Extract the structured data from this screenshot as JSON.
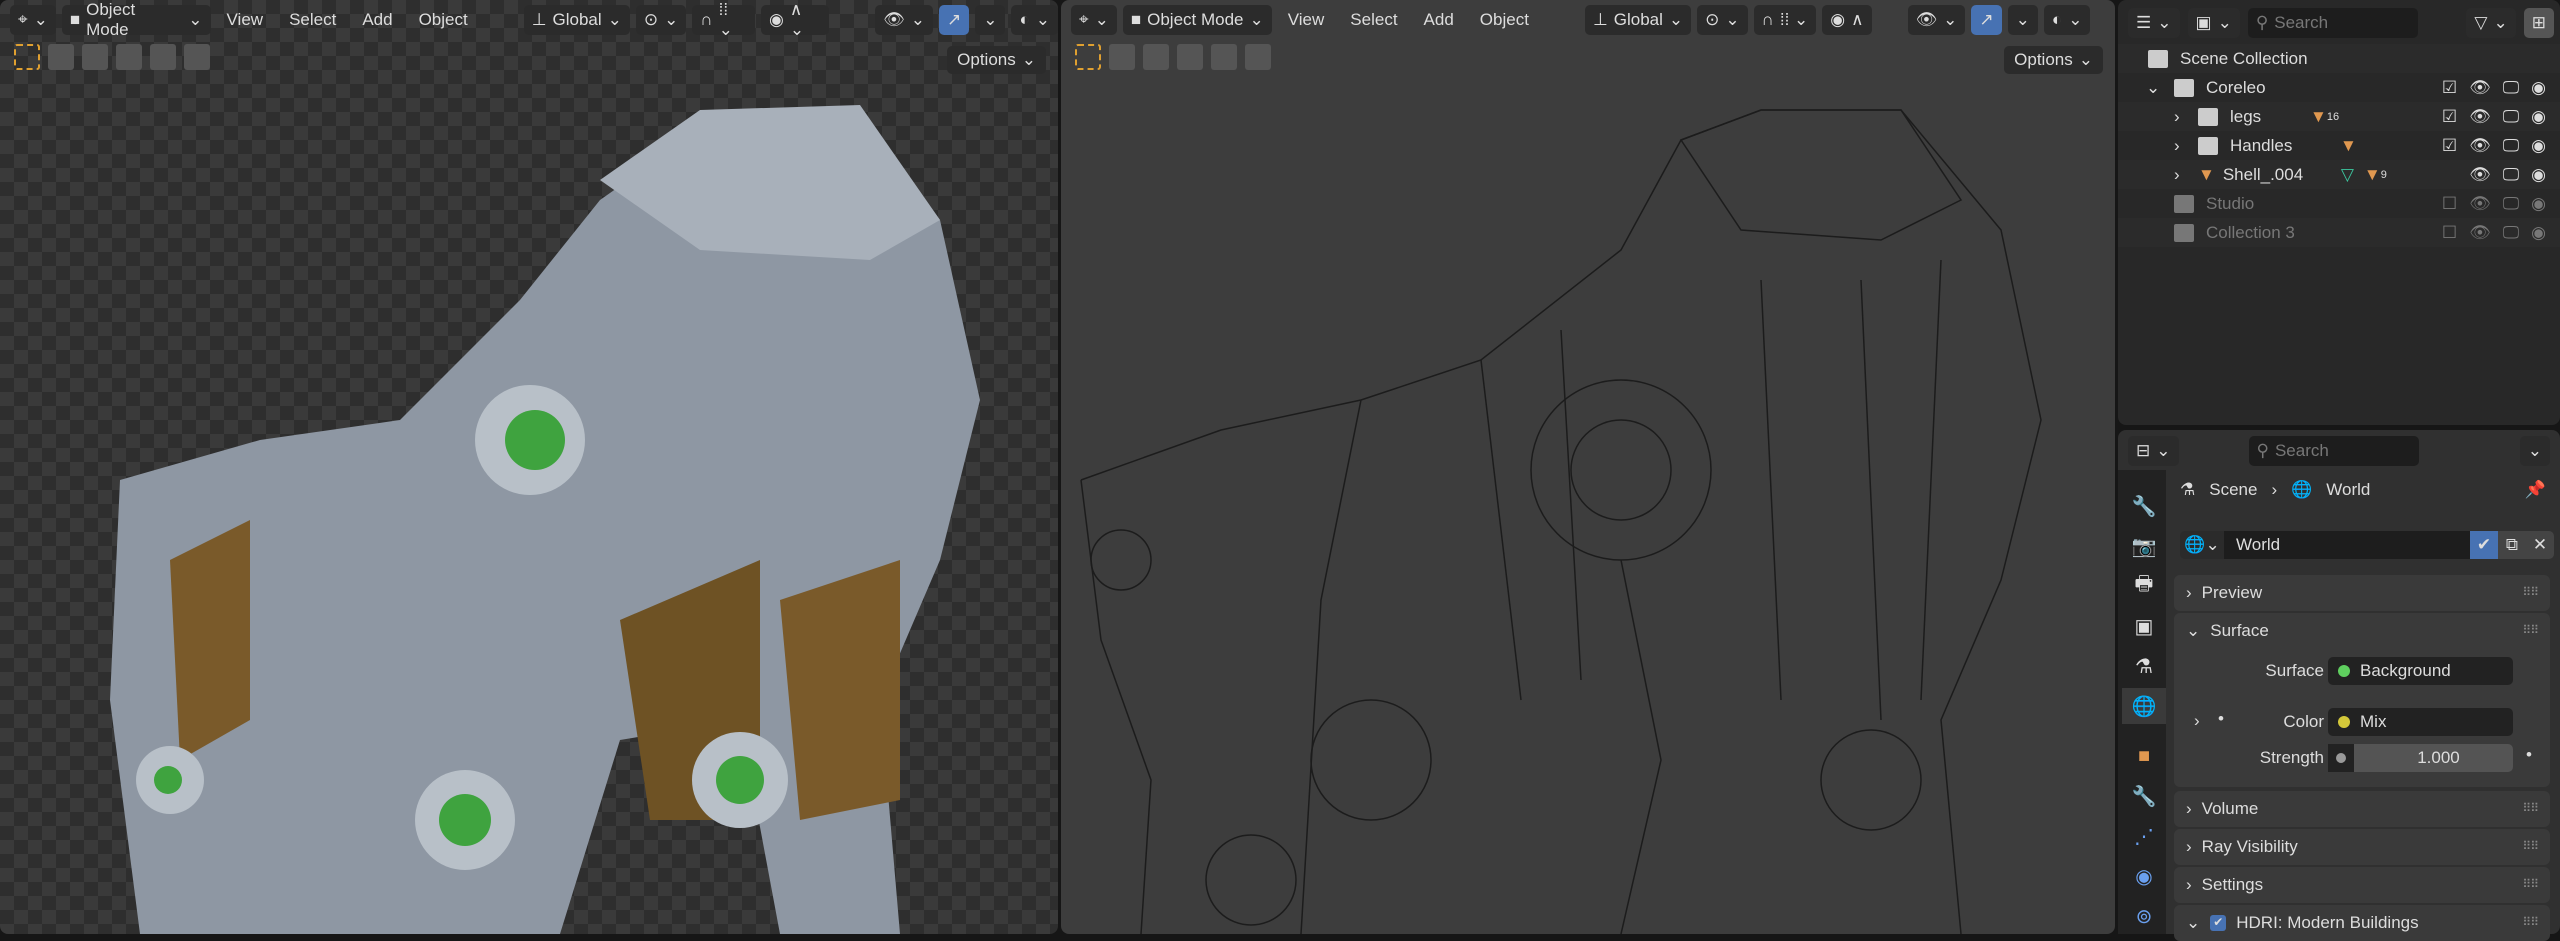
{
  "viewport_left": {
    "mode": "Object Mode",
    "menus": [
      "View",
      "Select",
      "Add",
      "Object"
    ],
    "orientation": "Global",
    "options": "Options"
  },
  "viewport_right": {
    "mode": "Object Mode",
    "menus": [
      "View",
      "Select",
      "Add",
      "Object"
    ],
    "orientation": "Global",
    "options": "Options"
  },
  "outliner": {
    "search_placeholder": "Search",
    "scene_collection": "Scene Collection",
    "rows": [
      {
        "name": "Coreleo",
        "badge": ""
      },
      {
        "name": "legs",
        "badge": "16"
      },
      {
        "name": "Handles",
        "badge": ""
      },
      {
        "name": "Shell_.004",
        "badge": "9"
      },
      {
        "name": "Studio",
        "badge": ""
      },
      {
        "name": "Collection 3",
        "badge": ""
      }
    ]
  },
  "properties": {
    "search_placeholder": "Search",
    "breadcrumb": [
      "Scene",
      "World"
    ],
    "world_name": "World",
    "panels": {
      "preview": "Preview",
      "surface": "Surface",
      "volume": "Volume",
      "ray_visibility": "Ray Visibility",
      "settings": "Settings",
      "hdri": "HDRI: Modern Buildings"
    },
    "surface_label": "Surface",
    "surface_value": "Background",
    "color_label": "Color",
    "color_value": "Mix",
    "strength_label": "Strength",
    "strength_value": "1.000"
  },
  "colors": {
    "accent": "#4772b3",
    "object": "#e09850",
    "green_socket": "#5fcf5f",
    "yellow_socket": "#d4c83a"
  }
}
